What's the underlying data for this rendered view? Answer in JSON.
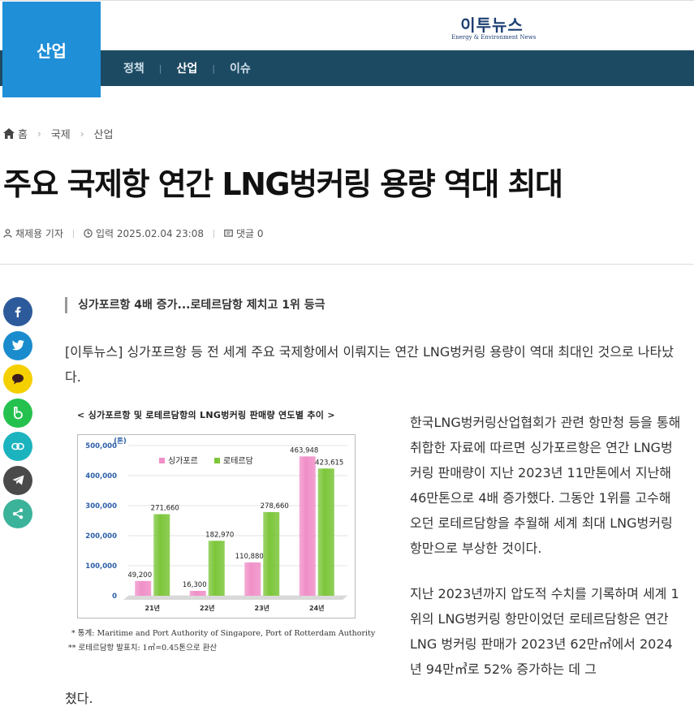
{
  "header": {
    "section_badge": "산업",
    "logo_main": "이투뉴스",
    "logo_sub": "Energy & Environment News",
    "nav": [
      {
        "label": "정책"
      },
      {
        "label": "산업"
      },
      {
        "label": "이슈"
      }
    ],
    "active_nav": "산업",
    "brand_color": "#1f8fd8",
    "nav_color": "#1d4a63"
  },
  "breadcrumb": [
    "홈",
    "국제",
    "산업"
  ],
  "article": {
    "title": "주요 국제항 연간 LNG벙커링 용량 역대 최대",
    "author": "채제용 기자",
    "published": "입력 2025.02.04 23:08",
    "comments": "댓글 0",
    "subhead": "싱가포르항 4배 증가...로테르담항 제치고 1위 등극",
    "p1": "[이투뉴스] 싱가포르항 등 전 세계 주요 국제항에서 이뤄지는 연간 LNG벙커링 용량이 역대 최대인 것으로 나타났다.",
    "p2": "한국LNG벙커링산업협회가 관련 항만청 등을 통해 취합한 자료에 따르면 싱가포르항은 연간 LNG벙커링 판매량이 지난 2023년 11만톤에서 지난해 46만톤으로 4배 증가했다. 그동안 1위를 고수해오던 로테르담항을 추월해 세계 최대 LNG벙커링 항만으로 부상한 것이다.",
    "p3": "지난 2023년까지 압도적 수치를 기록하며 세계 1위의 LNG벙커링 항만이었던 로테르담항은 연간 LNG 벙커링 판매가 2023년 62만㎥에서 2024년 94만㎥로 52% 증가하는 데 그",
    "p3_tail": "쳤다."
  },
  "share": [
    {
      "icon": "facebook-icon",
      "color": "#2d5a9b"
    },
    {
      "icon": "twitter-icon",
      "color": "#1a8ccd"
    },
    {
      "icon": "kakaotalk-icon",
      "color": "#f5d000"
    },
    {
      "icon": "band-icon",
      "color": "#25c14f"
    },
    {
      "icon": "link-icon",
      "color": "#1bb3be"
    },
    {
      "icon": "telegram-icon",
      "color": "#4a4a4a"
    },
    {
      "icon": "share-icon",
      "color": "#3bb39a"
    }
  ],
  "chart_data": {
    "type": "bar",
    "title": "< 싱가포르항 및 로테르담항의 LNG벙커링 판매량 연도별 추이 >",
    "ylabel": "(톤)",
    "categories": [
      "21년",
      "22년",
      "23년",
      "24년"
    ],
    "series": [
      {
        "name": "싱가포르",
        "color": "#f08fc8",
        "values": [
          49200,
          16300,
          110880,
          463948
        ],
        "labels": [
          "49,200",
          "16,300",
          "110,880",
          "463,948"
        ]
      },
      {
        "name": "로테르담",
        "color": "#7cc63a",
        "values": [
          271660,
          182970,
          278660,
          423615
        ],
        "labels": [
          "271,660",
          "182,970",
          "278,660",
          "423,615"
        ]
      }
    ],
    "ylim": [
      0,
      500000
    ],
    "yticks": [
      "0",
      "100,000",
      "200,000",
      "300,000",
      "400,000",
      "500,000"
    ],
    "legend": "top-left",
    "notes": [
      "* 통계: Maritime and Port Authority of Singapore, Port of Rotterdam Authority",
      "** 로테르담항 발표치: 1㎥=0.45톤으로 환산"
    ]
  }
}
